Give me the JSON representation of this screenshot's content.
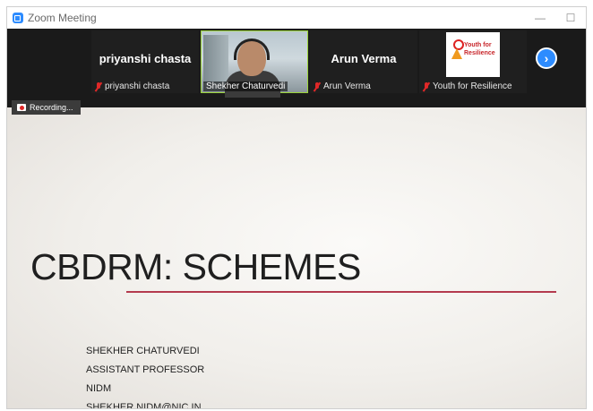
{
  "window": {
    "title": "Zoom Meeting",
    "controls": {
      "minimize": "—",
      "maximize": "☐"
    },
    "accent_color": "#2d8cff"
  },
  "participants": [
    {
      "display_name": "priyanshi chasta",
      "label": "priyanshi chasta",
      "muted": true,
      "video": false
    },
    {
      "display_name": "",
      "label": "Shekher Chaturvedi",
      "muted": false,
      "video": true
    },
    {
      "display_name": "Arun Verma",
      "label": "Arun Verma",
      "muted": true,
      "video": false
    },
    {
      "display_name": "",
      "label": "Youth for Resilience",
      "muted": true,
      "video": false,
      "logo_text": [
        "Youth for",
        "Resilience"
      ]
    }
  ],
  "strip_next_icon": "chevron-right-icon",
  "recording": {
    "label": "Recording..."
  },
  "slide": {
    "title": "CBDRM: SCHEMES",
    "rule_color": "#b43a4e",
    "author_lines": [
      "SHEKHER CHATURVEDI",
      "ASSISTANT PROFESSOR",
      "NIDM",
      "SHEKHER.NIDM@NIC.IN"
    ]
  }
}
